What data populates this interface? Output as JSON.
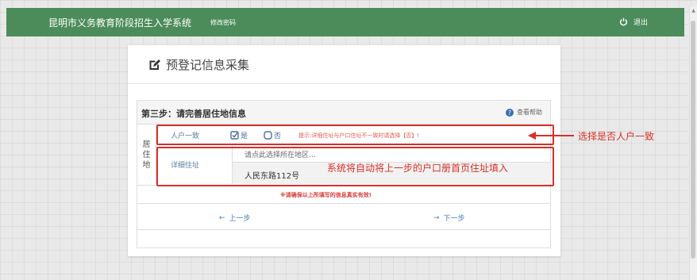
{
  "header": {
    "app_title": "昆明市义务教育阶段招生入学系统",
    "change_password": "修改密码",
    "logout": "退出"
  },
  "page": {
    "title": "预登记信息采集"
  },
  "step": {
    "title": "第三步：请完善居住地信息",
    "help": "查看帮助"
  },
  "residence": {
    "section_label": [
      "居",
      "住",
      "地"
    ],
    "same_household_label": "人户一致",
    "option_yes": "是",
    "option_no": "否",
    "hint": "提示:详细住址与户口住址不一致时请选择【否】!",
    "detail_label": "详细住址",
    "region_placeholder": "请点此选择所在地区...",
    "address_value": "人民东路112号"
  },
  "notice": "※请确保以上所填写的信息真实有效!",
  "nav": {
    "prev": "上一步",
    "next": "下一步"
  },
  "annotations": {
    "household": "选择是否人户一致",
    "address": "系统将自动将上一步的户口册首页住址填入"
  },
  "colors": {
    "header": "#4b8c5a",
    "annotation": "#d9302a",
    "link": "#4a7ab0"
  }
}
